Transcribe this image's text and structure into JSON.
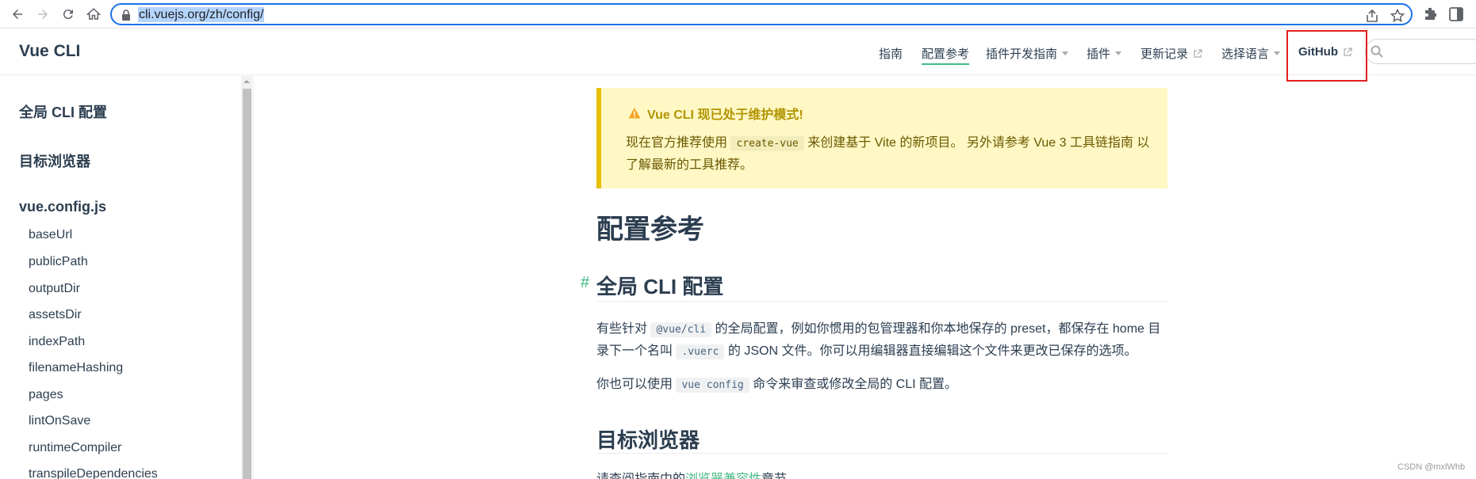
{
  "browser": {
    "url": "cli.vuejs.org/zh/config/"
  },
  "header": {
    "site_title": "Vue CLI",
    "nav": [
      {
        "label": "指南"
      },
      {
        "label": "配置参考"
      },
      {
        "label": "插件开发指南"
      },
      {
        "label": "插件"
      },
      {
        "label": "更新记录"
      },
      {
        "label": "选择语言"
      },
      {
        "label": "GitHub"
      }
    ],
    "search_placeholder": ""
  },
  "sidebar": {
    "groups": [
      {
        "label": "全局 CLI 配置"
      },
      {
        "label": "目标浏览器"
      },
      {
        "label": "vue.config.js"
      }
    ],
    "items": [
      {
        "label": "baseUrl"
      },
      {
        "label": "publicPath"
      },
      {
        "label": "outputDir"
      },
      {
        "label": "assetsDir"
      },
      {
        "label": "indexPath"
      },
      {
        "label": "filenameHashing"
      },
      {
        "label": "pages"
      },
      {
        "label": "lintOnSave"
      },
      {
        "label": "runtimeCompiler"
      },
      {
        "label": "transpileDependencies"
      }
    ]
  },
  "content": {
    "warning": {
      "title": "Vue CLI 现已处于维护模式!",
      "line1_a": "现在官方推荐使用",
      "code": "create-vue",
      "line1_b": "来创建基于 Vite 的新项目。 另外请参考 Vue 3 工具链指南 以",
      "line2": "了解最新的工具推荐。"
    },
    "title": "配置参考",
    "section1": {
      "heading": "全局 CLI 配置",
      "anchor": "#",
      "p1_a": "有些针对",
      "p1_code1": "@vue/cli",
      "p1_b": "的全局配置，例如你惯用的包管理器和你本地保存的 preset，都保存在 home 目",
      "p1_c": "录下一个名叫",
      "p1_code2": ".vuerc",
      "p1_d": "的 JSON 文件。你可以用编辑器直接编辑这个文件来更改已保存的选项。",
      "p2_a": "你也可以使用",
      "p2_code": "vue config",
      "p2_b": "命令来审查或修改全局的 CLI 配置。"
    },
    "section2": {
      "heading": "目标浏览器",
      "p_a": "请查阅指南中的",
      "p_link": "浏览器兼容性",
      "p_b": "章节。"
    }
  },
  "watermark": "CSDN @mxlWhb"
}
